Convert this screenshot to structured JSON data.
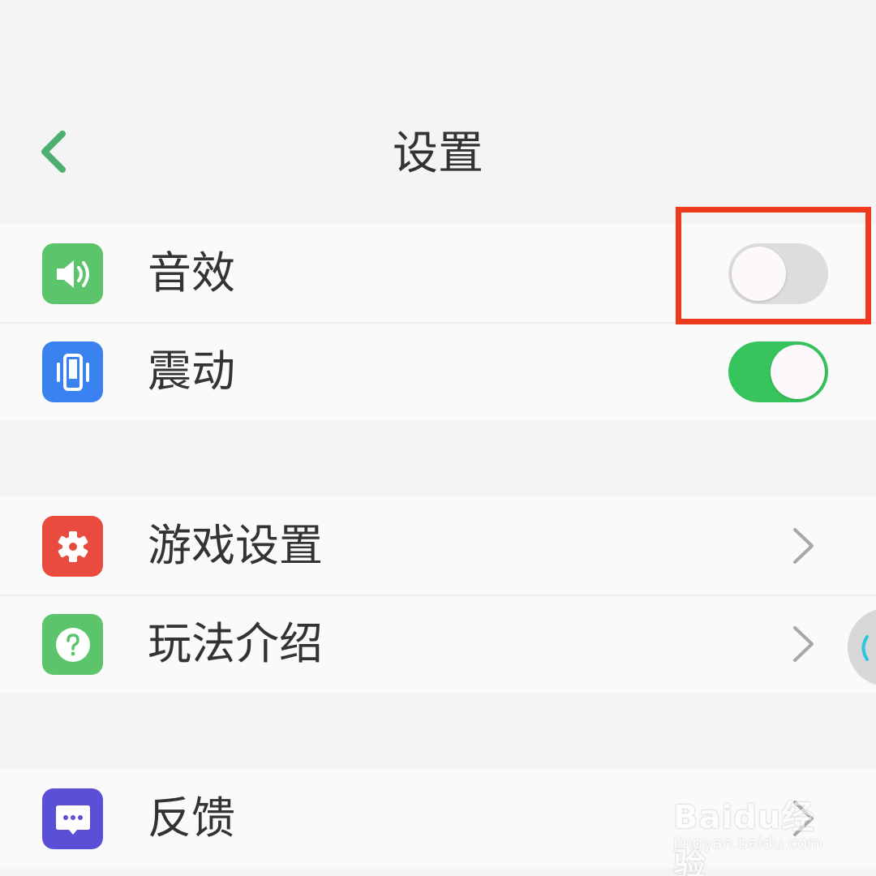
{
  "header": {
    "title": "设置",
    "back_icon": "chevron-left-icon",
    "accent_color": "#4caf6e"
  },
  "settings_groups": [
    {
      "items": [
        {
          "label": "音效",
          "icon": "speaker-icon",
          "icon_color": "#5cc46a",
          "control": "toggle",
          "enabled": false
        },
        {
          "label": "震动",
          "icon": "vibrate-icon",
          "icon_color": "#3a82f0",
          "control": "toggle",
          "enabled": true
        }
      ]
    },
    {
      "items": [
        {
          "label": "游戏设置",
          "icon": "gear-icon",
          "icon_color": "#ea4b3f",
          "control": "chevron"
        },
        {
          "label": "玩法介绍",
          "icon": "help-icon",
          "icon_color": "#5cc46a",
          "control": "chevron"
        }
      ]
    },
    {
      "items": [
        {
          "label": "反馈",
          "icon": "feedback-icon",
          "icon_color": "#5a4fd6",
          "control": "chevron"
        }
      ]
    }
  ],
  "colors": {
    "toggle_on": "#37c45c",
    "toggle_off": "#dddddd",
    "highlight": "#ee3b1d"
  },
  "watermark": {
    "logo": "Baidu经验",
    "url": "jingyan.baidu.com"
  }
}
